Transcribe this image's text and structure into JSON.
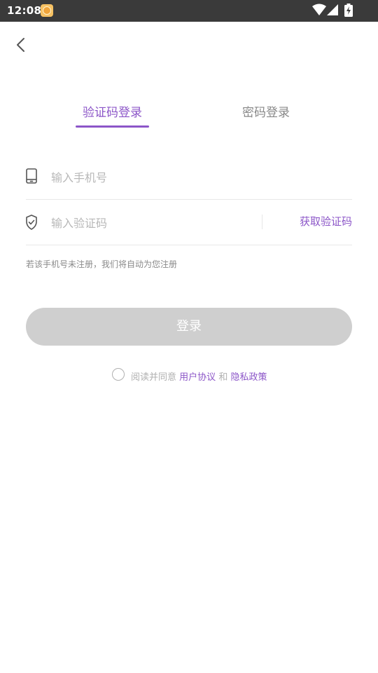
{
  "status_bar": {
    "time": "12:08",
    "icons": [
      "app-notification-icon",
      "wifi-icon",
      "signal-icon",
      "battery-charging-icon"
    ]
  },
  "nav": {
    "back_icon": "chevron-left-icon"
  },
  "tabs": [
    {
      "label": "验证码登录",
      "active": true
    },
    {
      "label": "密码登录",
      "active": false
    }
  ],
  "form": {
    "phone": {
      "icon": "phone-icon",
      "placeholder": "输入手机号",
      "value": ""
    },
    "code": {
      "icon": "shield-check-icon",
      "placeholder": "输入验证码",
      "value": "",
      "get_code_label": "获取验证码"
    },
    "hint": "若该手机号未注册，我们将自动为您注册"
  },
  "login_button": {
    "label": "登录",
    "enabled": false
  },
  "agreement": {
    "checked": false,
    "prefix": "阅读并同意",
    "user_agreement": "用户协议",
    "and": "和",
    "privacy_policy": "隐私政策"
  },
  "colors": {
    "accent": "#8c56c8",
    "status_bar_bg": "#3a3a3a",
    "button_disabled": "#cfcfcf"
  }
}
